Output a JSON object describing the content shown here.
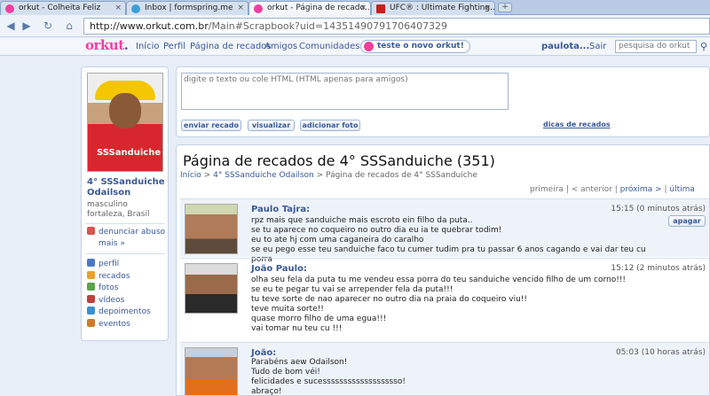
{
  "browser": {
    "tabs": [
      {
        "title": "orkut - Colheita Feliz",
        "active": false
      },
      {
        "title": "Inbox | formspring.me",
        "active": false
      },
      {
        "title": "orkut - Página de recado...",
        "active": true
      },
      {
        "title": "UFC® : Ultimate Fighting...",
        "active": false
      }
    ],
    "new_tab": "+",
    "url_host": "http://www.orkut.com.br",
    "url_path": "/Main#Scrapbook?uid=14351490791706407329"
  },
  "header": {
    "logo_main": "orkut",
    "logo_dot": ".",
    "nav": [
      "Início",
      "Perfil",
      "Página de recados",
      "Amigos",
      "Comunidades"
    ],
    "new_look": "teste o novo orkut!",
    "user": "paulota...",
    "logout": "Sair",
    "search_placeholder": "pesquisa do orkut"
  },
  "sidebar": {
    "shirt_text": "SSSanduiche",
    "name": "4° SSSanduiche Odailson",
    "meta1": "masculino",
    "meta2": "fortaleza, Brasil",
    "report": "denunciar abuso",
    "more": "mais »",
    "links": [
      {
        "label": "perfil",
        "color": "#4b78c4"
      },
      {
        "label": "recados",
        "color": "#e8a22a"
      },
      {
        "label": "fotos",
        "color": "#5aa34a"
      },
      {
        "label": "vídeos",
        "color": "#c04040"
      },
      {
        "label": "depoimentos",
        "color": "#3b8fd0"
      },
      {
        "label": "eventos",
        "color": "#d07a2a"
      }
    ]
  },
  "compose": {
    "placeholder": "digite o texto ou cole HTML (HTML apenas para amigos)",
    "send": "enviar recado",
    "preview": "visualizar",
    "add_photo": "adicionar foto",
    "tips": "dicas de recados"
  },
  "main": {
    "title": "Página de recados de 4° SSSanduiche (351)",
    "breadcrumb": [
      "Início",
      "4° SSSanduiche Odailson",
      "Página de recados de 4° SSSanduiche"
    ],
    "breadcrumb_sep": ">",
    "pager": {
      "first": "primeira",
      "prev": "< anterior",
      "next": "próxima >",
      "last": "última",
      "sep": "|"
    },
    "delete_label": "apagar",
    "scraps": [
      {
        "author": "Paulo Tajra:",
        "time": "15:15 (0 minutos atrás)",
        "text": "rpz mais que sanduiche mais escroto ein filho da puta..\nse tu aparece no coqueiro no outro dia eu ia te quebrar todim!\neu to ate hj com uma caganeira do caralho\nse eu pego esse teu sanduiche faco tu cumer tudim pra tu passar 6 anos cagando e vai dar teu cu porra"
      },
      {
        "author": "João Paulo:",
        "time": "15:12 (2 minutos atrás)",
        "text": "olha seu fela da puta tu me vendeu essa porra do teu sanduiche vencido filho de um corno!!!\nse eu te pegar tu vai se arrepender fela da puta!!!\ntu teve sorte de nao aparecer no outro dia na praia do coqueiro viu!!\nteve muita sorte!!\nquase morro filho de uma egua!!!\nvai tomar nu teu cu !!!"
      },
      {
        "author": "João:",
        "time": "05:03 (10 horas atrás)",
        "text": "Parabéns aew Odailson!\nTudo de bom véi!\nfelicidades e sucesssssssssssssssssso!\nabraço!"
      }
    ]
  }
}
